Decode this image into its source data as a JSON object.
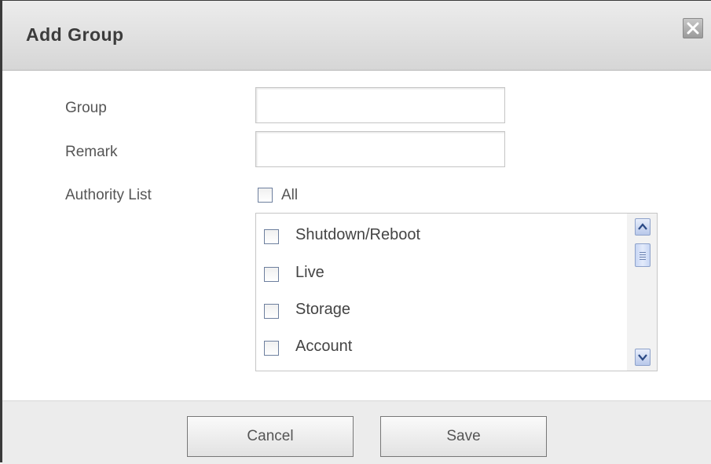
{
  "dialog": {
    "title": "Add Group",
    "close_icon": "close-icon"
  },
  "form": {
    "group_label": "Group",
    "group_value": "",
    "remark_label": "Remark",
    "remark_value": "",
    "authority_label": "Authority List",
    "all_label": "All",
    "all_checked": false
  },
  "authority_list": {
    "items": [
      {
        "label": "Shutdown/Reboot",
        "checked": false
      },
      {
        "label": "Live",
        "checked": false
      },
      {
        "label": "Storage",
        "checked": false
      },
      {
        "label": "Account",
        "checked": false
      }
    ],
    "scroll_up_icon": "chevron-up-icon",
    "scroll_down_icon": "chevron-down-icon"
  },
  "footer": {
    "cancel_label": "Cancel",
    "save_label": "Save"
  }
}
